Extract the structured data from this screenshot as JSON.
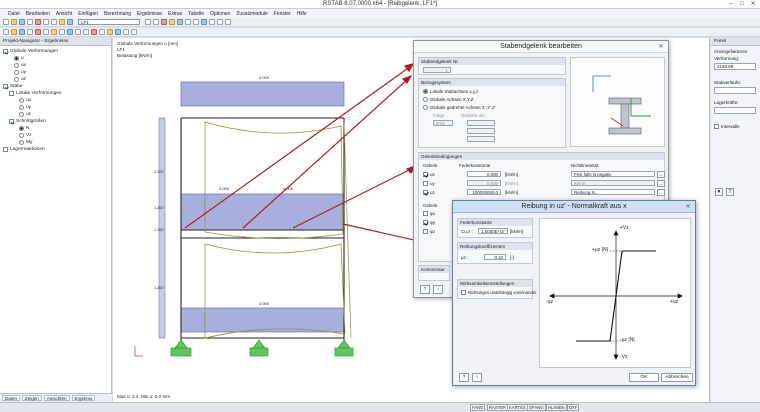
{
  "window": {
    "title": "RSTAB 8.07.0000 x64 - [Reibgelenk, LF1*]"
  },
  "menu": [
    "Datei",
    "Bearbeiten",
    "Ansicht",
    "Einfügen",
    "Berechnung",
    "Ergebnisse",
    "Extras",
    "Tabelle",
    "Optionen",
    "Zusatzmodule",
    "Fenster",
    "Hilfe"
  ],
  "toolbar": {
    "loadcase": "LF1"
  },
  "navigator": {
    "title": "Projekt-Navigator - Ergebnisse",
    "items": {
      "globale": "Globale Verformungen",
      "u": "u",
      "ux": "ux",
      "uy": "uy",
      "uz": "uz",
      "staebe": "Stäbe",
      "lokale": "Lokale Verformungen",
      "lux": "ux",
      "luy": "uy",
      "luz": "uz",
      "schnitt": "Schnittgrößen",
      "n": "N",
      "vz": "Vz",
      "my": "My",
      "lager": "Lagerreaktionen"
    },
    "tabs": [
      "Daten",
      "Zeigen",
      "Ansichten",
      "Ergebnis"
    ]
  },
  "workarea": {
    "info1": "Globale Verformungen u [mm]",
    "info2": "LF1",
    "info3": "Belastung [kN/m]",
    "bottom": "Max u: 3.4, Min u: 0.0 mm",
    "load_top": "4.000",
    "load_mid1": "4.000",
    "load_mid2": "4.000",
    "load_bot": "4.000",
    "dim1": "1.200",
    "dim2": "1.200",
    "dim3": "1.200",
    "dim4": "1.200"
  },
  "rightpanel": {
    "title": "Panel",
    "label1": "Anzeigefaktoren",
    "label2": "Verformung:",
    "factor": "2150.89",
    "label3": "Stabverläufe:",
    "label4": "Lagerkräfte:",
    "label5": "Intervalle"
  },
  "status": [
    "FANG",
    "RASTER",
    "KARTES",
    "OFANG",
    "HLINIEN",
    "DXF"
  ],
  "dialog1": {
    "title": "Stabendgelenk bearbeiten",
    "g1": "Stabendgelenk Nr.",
    "g1_value": "1",
    "g2": "Bezugssystem",
    "opt1": "Lokale Stabachsen x,y,z",
    "opt2": "Globale Achsen X,Y,Z",
    "opt3": "Globale gedrehte Achsen X',Y',Z'",
    "folge_label": "Folge",
    "folge_value": "XYZ",
    "gedreht": "Gedreht um",
    "g3": "Gelenkbedingungen",
    "gelenk": "Gelenk",
    "feder": "Federkonstante",
    "nicht": "Nichtlinearität",
    "ux": "ux",
    "uy": "uy",
    "uz": "uz",
    "cux": "0.000",
    "cuy": "0.000",
    "cuz": "100000000.0",
    "unit1": "[kN/m]",
    "unit2": "[kN/m]",
    "unit3": "[kN/m]",
    "nl1": "Fest falls N negativ",
    "nl2": "Keine",
    "nl3": "Reibung N...",
    "gelenk2": "Gelenk",
    "phix": "φx",
    "phiy": "φy",
    "phiz": "φz",
    "kommentar": "Kommentar"
  },
  "dialog2": {
    "title": "Reibung in uz' - Normalkraft aus x",
    "g1": "Federkonstante",
    "cu_label": "Cu,z :",
    "cu_value": "1.0000E+07",
    "cu_unit": "[kN/m]",
    "g2": "Reibungskoeffizienten",
    "mu_label": "μz :",
    "mu_value": "0.10",
    "mu_unit": "[-]",
    "g3": "Wirksamkeitseinstellungen",
    "cb_label": "Richtungen unabhängig voneinander",
    "graph_vz_top": "+Vz",
    "graph_vz_bot": "-Vz",
    "graph_uz_r": "+uz",
    "graph_uz_l": "-uz",
    "graph_pos": "+μz |N|",
    "graph_neg": "-μz |N|",
    "ok": "OK",
    "cancel": "Abbrechen"
  }
}
